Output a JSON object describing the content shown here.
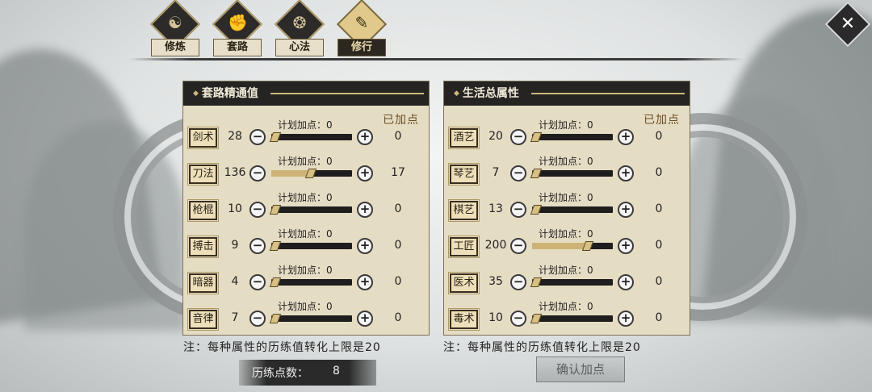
{
  "tabs": [
    {
      "label": "修炼",
      "icon": "lotus-icon",
      "glyph": "☯",
      "active": false
    },
    {
      "label": "套路",
      "icon": "fist-icon",
      "glyph": "✊",
      "active": false
    },
    {
      "label": "心法",
      "icon": "swirl-icon",
      "glyph": "❂",
      "active": false
    },
    {
      "label": "修行",
      "icon": "brush-icon",
      "glyph": "✎",
      "active": true
    }
  ],
  "close_glyph": "✕",
  "left_panel": {
    "title": "套路精通值",
    "added_header": "已加点",
    "plan_prefix": "计划加点：",
    "rows": [
      {
        "name": "剑术",
        "value": "28",
        "plan": "0",
        "added": "0",
        "fill": 0.0
      },
      {
        "name": "刀法",
        "value": "136",
        "plan": "0",
        "added": "17",
        "fill": 0.5
      },
      {
        "name": "枪棍",
        "value": "10",
        "plan": "0",
        "added": "0",
        "fill": 0.0
      },
      {
        "name": "搏击",
        "value": "9",
        "plan": "0",
        "added": "0",
        "fill": 0.0
      },
      {
        "name": "暗器",
        "value": "4",
        "plan": "0",
        "added": "0",
        "fill": 0.0
      },
      {
        "name": "音律",
        "value": "7",
        "plan": "0",
        "added": "0",
        "fill": 0.0
      }
    ],
    "note": "注：每种属性的历练值转化上限是20"
  },
  "right_panel": {
    "title": "生活总属性",
    "added_header": "已加点",
    "plan_prefix": "计划加点：",
    "rows": [
      {
        "name": "酒艺",
        "value": "20",
        "plan": "0",
        "added": "0",
        "fill": 0.0
      },
      {
        "name": "琴艺",
        "value": "7",
        "plan": "0",
        "added": "0",
        "fill": 0.0
      },
      {
        "name": "棋艺",
        "value": "13",
        "plan": "0",
        "added": "0",
        "fill": 0.0
      },
      {
        "name": "工匠",
        "value": "200",
        "plan": "0",
        "added": "0",
        "fill": 0.7
      },
      {
        "name": "医术",
        "value": "35",
        "plan": "0",
        "added": "0",
        "fill": 0.0
      },
      {
        "name": "毒术",
        "value": "10",
        "plan": "0",
        "added": "0",
        "fill": 0.0
      }
    ],
    "note": "注：每种属性的历练值转化上限是20"
  },
  "points": {
    "label": "历练点数：",
    "value": "8"
  },
  "confirm_label": "确认加点",
  "colors": {
    "accent": "#cdb476",
    "panel_bg": "#e5dcc4",
    "header_bg": "#252422"
  }
}
